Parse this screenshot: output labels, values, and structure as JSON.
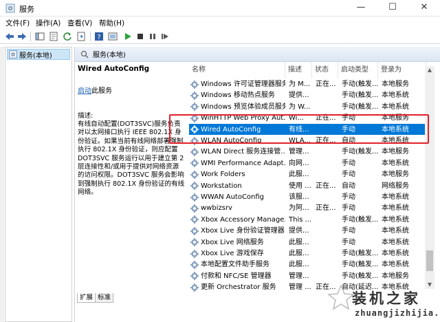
{
  "window": {
    "title": "服务",
    "icon": "services-gear-icon"
  },
  "menubar": {
    "items": [
      "文件(F)",
      "操作(A)",
      "查看(V)",
      "帮助(H)"
    ]
  },
  "toolbar": {
    "icons": [
      "back-arrow-icon",
      "forward-arrow-icon",
      "console-tree-icon",
      "properties-icon",
      "refresh-icon",
      "export-list-icon",
      "help-icon",
      "view-icon",
      "start-service-icon",
      "stop-service-icon",
      "pause-service-icon",
      "restart-service-icon"
    ]
  },
  "tree": {
    "item": "服务(本地)"
  },
  "pane": {
    "header": "服务(本地)"
  },
  "description": {
    "service_title": "Wired AutoConfig",
    "action_link": "启动",
    "action_suffix": "此服务",
    "label": "描述:",
    "body": "有线自动配置(DOT3SVC)服务负责对以太网接口执行 IEEE 802.1X 身份验证。如果当前有线网络部署强制执行 802.1X 身份验证，则应配置 DOT3SVC 服务运行以用于建立第 2 层连接性和/或用于提供对网络资源的访问权限。DOT3SVC 服务会影响到强制执行 802.1X 身份验证的有线网络。"
  },
  "table": {
    "columns": [
      "名称",
      "描述",
      "状态",
      "启动类型",
      "登录为"
    ],
    "rows": [
      {
        "name": "Windows 许可证管理器服务",
        "desc": "为 M...",
        "status": "正在...",
        "startup": "手动(触发...",
        "logon": "本地服务",
        "selected": false
      },
      {
        "name": "Windows 移动热点服务",
        "desc": "提供...",
        "status": "",
        "startup": "手动(触发...",
        "logon": "本地系统",
        "selected": false
      },
      {
        "name": "Windows 预览体验成员服务",
        "desc": "为 W...",
        "status": "",
        "startup": "手动(触发...",
        "logon": "本地系统",
        "selected": false
      },
      {
        "name": "WinHTTP Web Proxy Aut...",
        "desc": "Wi...",
        "status": "正在...",
        "startup": "手动",
        "logon": "本地服务",
        "selected": false
      },
      {
        "name": "Wired AutoConfig",
        "desc": "有线...",
        "status": "",
        "startup": "手动",
        "logon": "本地系统",
        "selected": true
      },
      {
        "name": "WLAN AutoConfig",
        "desc": "WLA...",
        "status": "正在...",
        "startup": "自动",
        "logon": "本地系统",
        "selected": false
      },
      {
        "name": "WLAN Direct 服务连接管...",
        "desc": "管理...",
        "status": "",
        "startup": "手动(触发...",
        "logon": "本地服务",
        "selected": false
      },
      {
        "name": "WMI Performance Adapt...",
        "desc": "向网...",
        "status": "",
        "startup": "手动",
        "logon": "本地系统",
        "selected": false
      },
      {
        "name": "Work Folders",
        "desc": "此服...",
        "status": "",
        "startup": "手动",
        "logon": "本地服务",
        "selected": false
      },
      {
        "name": "Workstation",
        "desc": "使用 ...",
        "status": "正在...",
        "startup": "自动",
        "logon": "网络服务",
        "selected": false
      },
      {
        "name": "WWAN AutoConfig",
        "desc": "该服...",
        "status": "",
        "startup": "手动",
        "logon": "本地系统",
        "selected": false
      },
      {
        "name": "wwbizsrv",
        "desc": "为阿...",
        "status": "正在...",
        "startup": "手动",
        "logon": "本地系统",
        "selected": false
      },
      {
        "name": "Xbox Accessory Manage...",
        "desc": "This ...",
        "status": "",
        "startup": "手动(触发...",
        "logon": "本地系统",
        "selected": false
      },
      {
        "name": "Xbox Live 身份验证管理器",
        "desc": "提供...",
        "status": "",
        "startup": "手动",
        "logon": "本地系统",
        "selected": false
      },
      {
        "name": "Xbox Live 网络服务",
        "desc": "此服...",
        "status": "",
        "startup": "手动",
        "logon": "本地系统",
        "selected": false
      },
      {
        "name": "Xbox Live 游戏保存",
        "desc": "此服...",
        "status": "",
        "startup": "手动(触发...",
        "logon": "本地系统",
        "selected": false
      },
      {
        "name": "本地配置文件助手服务",
        "desc": "此服...",
        "status": "",
        "startup": "手动(触发...",
        "logon": "本地系统",
        "selected": false
      },
      {
        "name": "付款和 NFC/SE 管理器",
        "desc": "管理...",
        "status": "",
        "startup": "手动(触发...",
        "logon": "本地服务",
        "selected": false
      },
      {
        "name": "更新 Orchestrator 服务",
        "desc": "管理 ...",
        "status": "正在...",
        "startup": "自动(延迟...",
        "logon": "本地系统",
        "selected": false
      }
    ]
  },
  "tabs": [
    "扩展",
    "标准"
  ],
  "watermark": {
    "text": "装机之家",
    "url": "zhuangjizhijia.com"
  },
  "colors": {
    "selection": "#0078d7",
    "highlight_border": "#e0202a",
    "link": "#1a5fb4"
  }
}
